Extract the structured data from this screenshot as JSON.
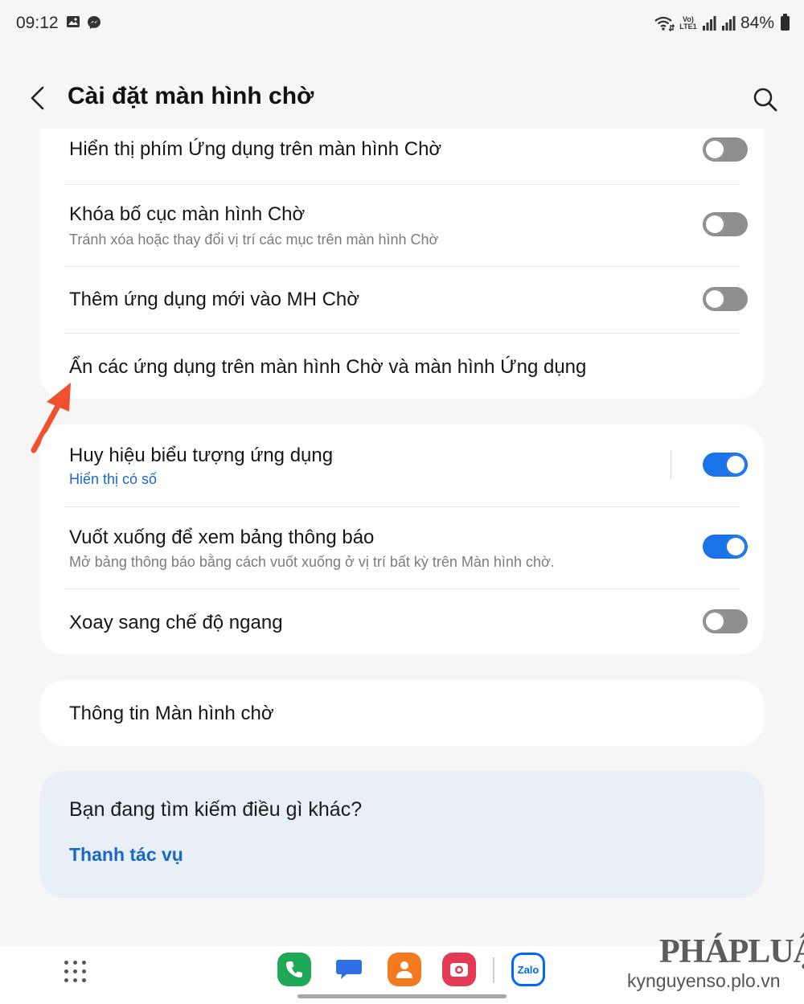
{
  "status_bar": {
    "time": "09:12",
    "volte": "Vo) LTE1",
    "battery": "84%",
    "icons": [
      "gallery-icon",
      "messenger-icon",
      "wifi-icon",
      "volte-icon",
      "signal-icon",
      "signal-icon",
      "battery-icon"
    ]
  },
  "header": {
    "title": "Cài đặt màn hình chờ",
    "back_icon": "chevron-left-icon",
    "search_icon": "search-icon"
  },
  "group1": {
    "items": [
      {
        "title": "Hiển thị phím Ứng dụng trên màn hình Chờ",
        "toggle": "off"
      },
      {
        "title": "Khóa bố cục màn hình Chờ",
        "subtitle": "Tránh xóa hoặc thay đổi vị trí các mục trên màn hình Chờ",
        "toggle": "off"
      },
      {
        "title": "Thêm ứng dụng mới vào MH Chờ",
        "toggle": "off"
      },
      {
        "title": "Ẩn các ứng dụng trên màn hình Chờ và màn hình Ứng dụng"
      }
    ]
  },
  "group2": {
    "items": [
      {
        "title": "Huy hiệu biểu tượng ứng dụng",
        "subtitle": "Hiển thị có số",
        "toggle": "on"
      },
      {
        "title": "Vuốt xuống để xem bảng thông báo",
        "subtitle": "Mở bảng thông báo bằng cách vuốt xuống ở vị trí bất kỳ trên Màn hình chờ.",
        "toggle": "on"
      },
      {
        "title": "Xoay sang chế độ ngang",
        "toggle": "off"
      }
    ]
  },
  "group3": {
    "title": "Thông tin Màn hình chờ"
  },
  "suggest": {
    "title": "Bạn đang tìm kiếm điều gì khác?",
    "link": "Thanh tác vụ"
  },
  "dock": {
    "apps": [
      {
        "name": "phone-app",
        "color": "#1fa855"
      },
      {
        "name": "messages-app",
        "color": "#2f6fe4"
      },
      {
        "name": "contacts-app",
        "color": "#f47a20"
      },
      {
        "name": "camera-app",
        "color": "#e23a55"
      },
      {
        "name": "zalo-app",
        "label": "Zalo",
        "color": "#0068ff"
      }
    ]
  },
  "watermark": {
    "brand": "PHÁPLUẬT",
    "site": "kynguyenso.plo.vn"
  },
  "colors": {
    "accent": "#1a73e8",
    "link": "#1868c8",
    "toggle_off": "#8e8e8e",
    "arrow": "#f0502d"
  }
}
